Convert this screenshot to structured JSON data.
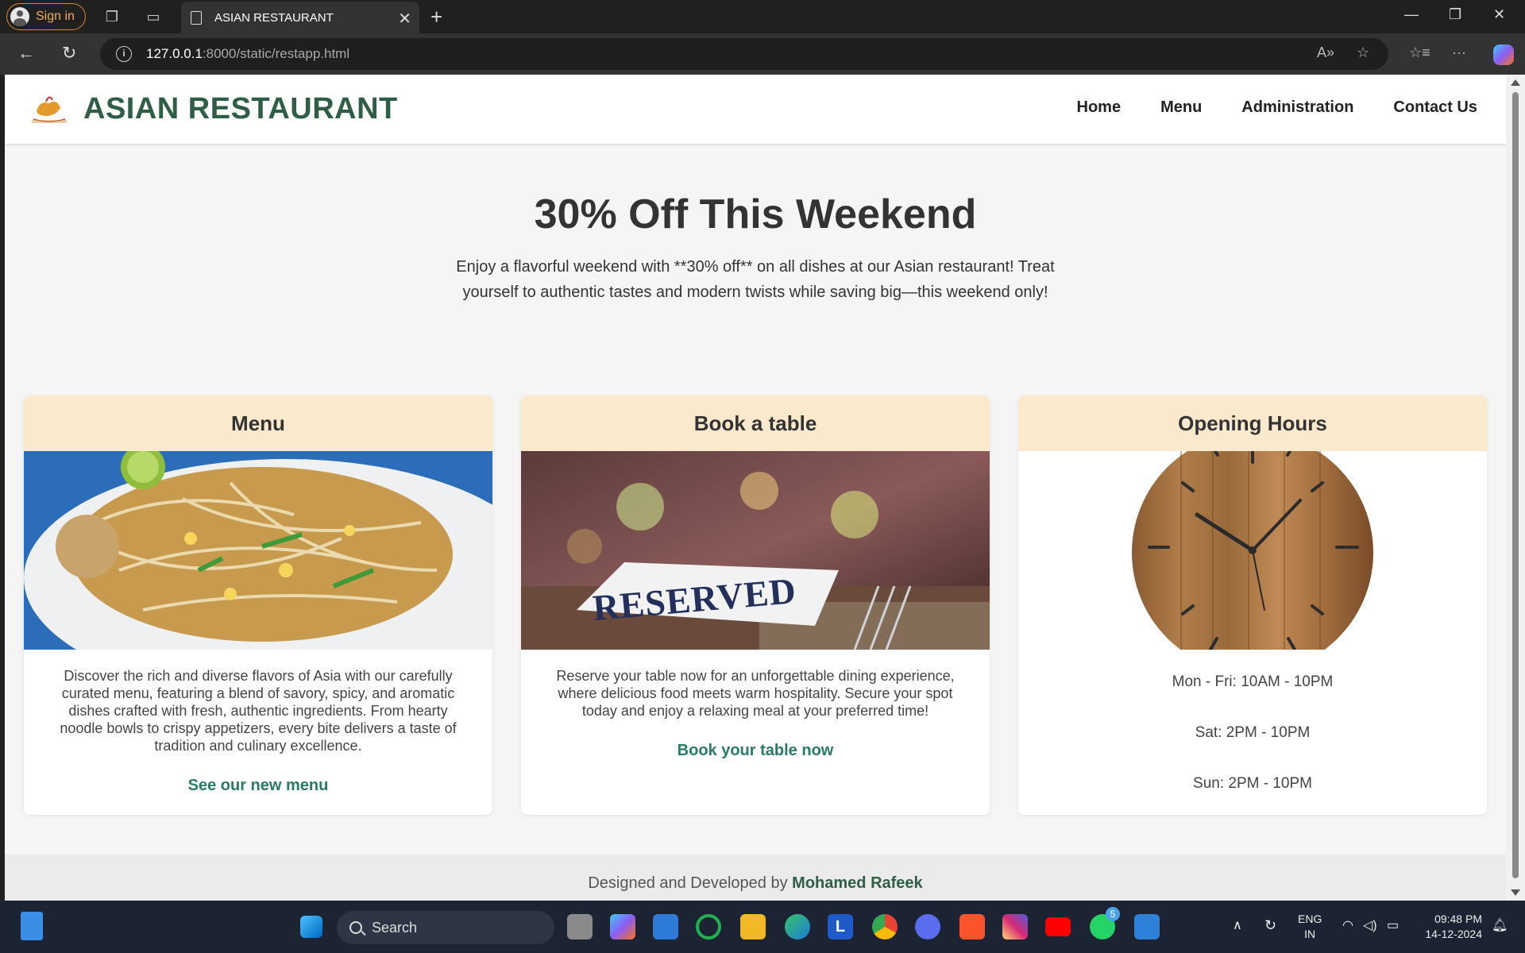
{
  "browser": {
    "signin_label": "Sign in",
    "tab_title": "ASIAN RESTAURANT",
    "url_host": "127.0.0.1",
    "url_path": ":8000/static/restapp.html"
  },
  "site": {
    "brand": "ASIAN RESTAURANT",
    "nav": [
      "Home",
      "Menu",
      "Administration",
      "Contact Us"
    ]
  },
  "hero": {
    "title": "30% Off This Weekend",
    "text": "Enjoy a flavorful weekend with **30% off** on all dishes at our Asian restaurant! Treat yourself to authentic tastes and modern twists while saving big—this weekend only!"
  },
  "cards": {
    "menu": {
      "title": "Menu",
      "text": "Discover the rich and diverse flavors of Asia with our carefully curated menu, featuring a blend of savory, spicy, and aromatic dishes crafted with fresh, authentic ingredients. From hearty noodle bowls to crispy appetizers, every bite delivers a taste of tradition and culinary excellence.",
      "link": "See our new menu"
    },
    "book": {
      "title": "Book a table",
      "text": "Reserve your table now for an unforgettable dining experience, where delicious food meets warm hospitality. Secure your spot today and enjoy a relaxing meal at your preferred time!",
      "link": "Book your table now",
      "sign_text": "RESERVED"
    },
    "hours": {
      "title": "Opening Hours",
      "lines": [
        "Mon - Fri: 10AM - 10PM",
        "Sat: 2PM - 10PM",
        "Sun: 2PM - 10PM"
      ]
    }
  },
  "footer": {
    "prefix": "Designed and Developed by",
    "author": "Mohamed Rafeek"
  },
  "taskbar": {
    "search_label": "Search",
    "lang_1": "ENG",
    "lang_2": "IN",
    "time": "09:48 PM",
    "date": "14-12-2024",
    "whatsapp_badge": "5"
  },
  "colors": {
    "brand_green": "#2e5e45",
    "link_teal": "#2a7a6a",
    "card_header": "#fbe9cd"
  }
}
